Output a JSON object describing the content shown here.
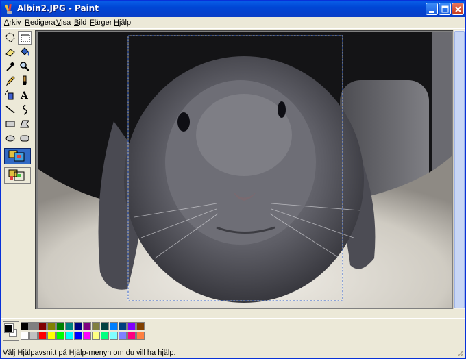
{
  "window": {
    "title": "Albin2.JPG - Paint"
  },
  "menu": [
    {
      "label": "Arkiv",
      "acc": "A",
      "rest": "rkiv"
    },
    {
      "label": "Redigera",
      "acc": "R",
      "rest": "edigera"
    },
    {
      "label": "Visa",
      "acc": "V",
      "rest": "isa"
    },
    {
      "label": "Bild",
      "acc": "B",
      "rest": "ild"
    },
    {
      "label": "Färger",
      "acc": "F",
      "rest": "ärger"
    },
    {
      "label": "Hjälp",
      "acc": "H",
      "rest": "jälp"
    }
  ],
  "tools": [
    "free-form-select",
    "select",
    "eraser",
    "fill-with-color",
    "pick-color",
    "magnifier",
    "pencil",
    "brush",
    "airbrush",
    "text",
    "line",
    "curve",
    "rectangle",
    "polygon",
    "ellipse",
    "rounded-rectangle"
  ],
  "active_tool": "select",
  "colors": {
    "foreground": "#000000",
    "background": "#ffffff",
    "palette_top": [
      "#000000",
      "#808080",
      "#800000",
      "#808000",
      "#008000",
      "#008080",
      "#000080",
      "#800080",
      "#808040",
      "#004040",
      "#0080ff",
      "#004080",
      "#8000ff",
      "#804000"
    ],
    "palette_bottom": [
      "#ffffff",
      "#c0c0c0",
      "#ff0000",
      "#ffff00",
      "#00ff00",
      "#00ffff",
      "#0000ff",
      "#ff00ff",
      "#ffff80",
      "#00ff80",
      "#80ffff",
      "#8080ff",
      "#ff0080",
      "#ff8040"
    ]
  },
  "status": {
    "text": "Välj Hjälpavsnitt på Hjälp-menyn om du vill ha hjälp."
  }
}
